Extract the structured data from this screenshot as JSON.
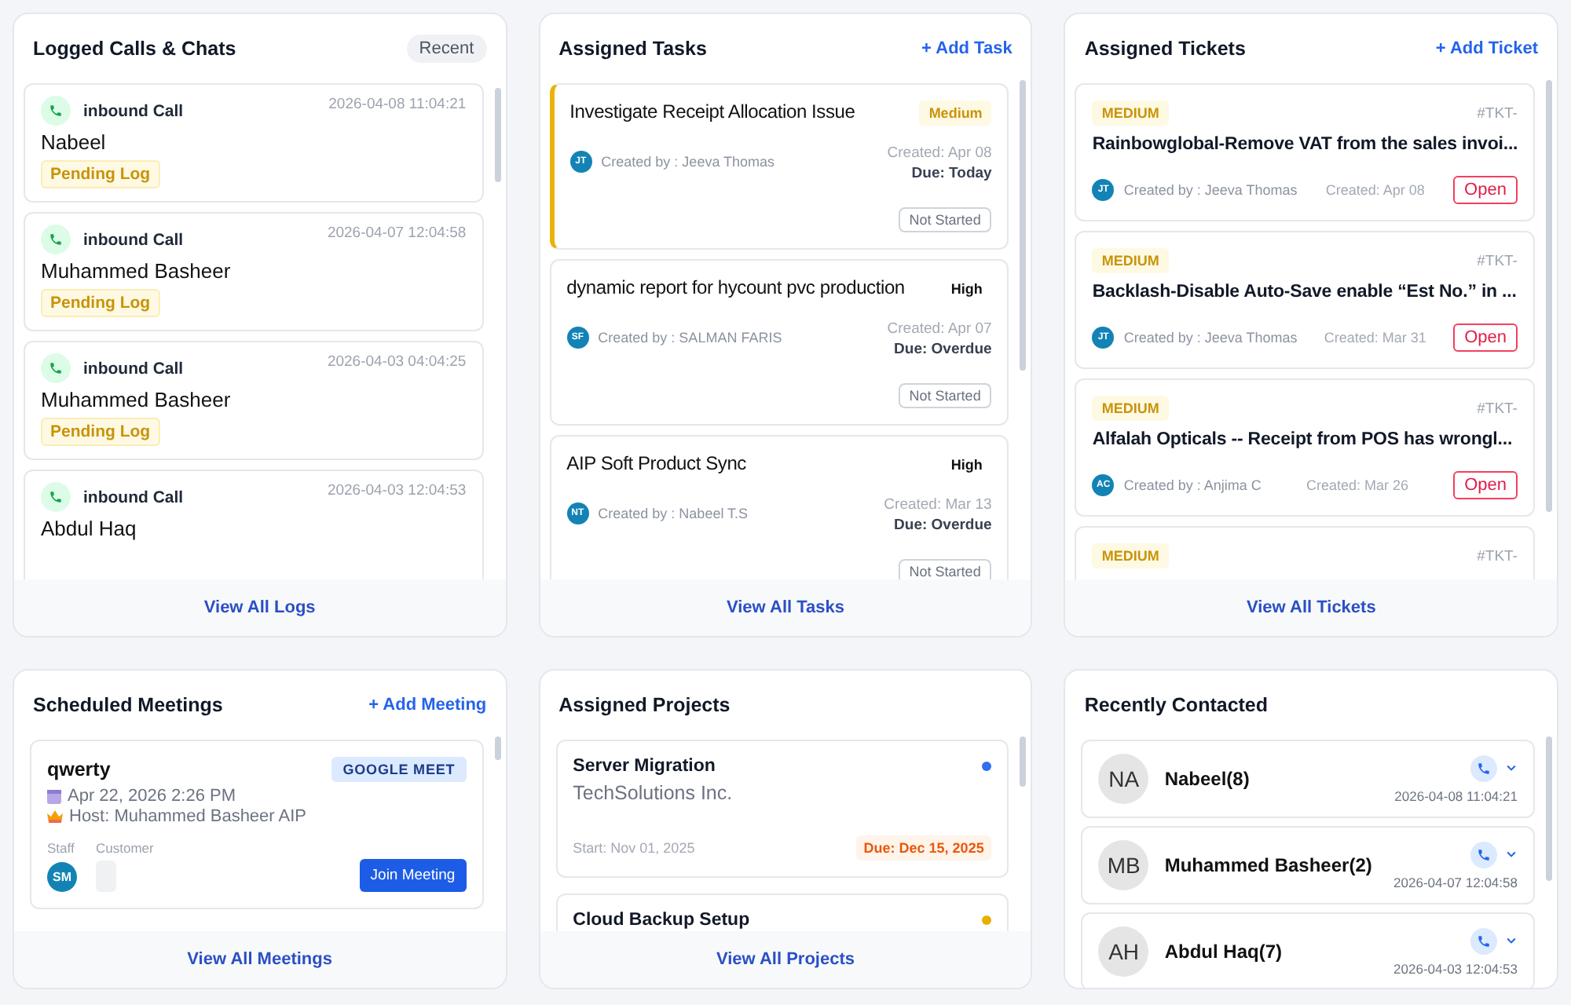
{
  "logs": {
    "title": "Logged Calls & Chats",
    "badge": "Recent",
    "items": [
      {
        "type": "inbound Call",
        "time": "2026-04-08 11:04:21",
        "name": "Nabeel",
        "status": "Pending Log"
      },
      {
        "type": "inbound Call",
        "time": "2026-04-07 12:04:58",
        "name": "Muhammed Basheer",
        "status": "Pending Log"
      },
      {
        "type": "inbound Call",
        "time": "2026-04-03 04:04:25",
        "name": "Muhammed Basheer",
        "status": "Pending Log"
      },
      {
        "type": "inbound Call",
        "time": "2026-04-03 12:04:53",
        "name": "Abdul Haq"
      }
    ],
    "footer": "View All Logs"
  },
  "tasks": {
    "title": "Assigned Tasks",
    "action": "+ Add Task",
    "items": [
      {
        "title": "Investigate Receipt Allocation Issue",
        "priority": "Medium",
        "kind": "medium",
        "initials": "JT",
        "creator": "Created by : Jeeva Thomas",
        "created": "Created: Apr 08",
        "due": "Due: Today",
        "status": "Not Started"
      },
      {
        "title": "dynamic report for hycount pvc production",
        "priority": "High",
        "kind": "high",
        "initials": "SF",
        "creator": "Created by : SALMAN FARIS",
        "created": "Created: Apr 07",
        "due": "Due: Overdue",
        "status": "Not Started"
      },
      {
        "title": "AIP Soft Product Sync",
        "priority": "High",
        "kind": "high",
        "initials": "NT",
        "creator": "Created by : Nabeel T.S",
        "created": "Created: Mar 13",
        "due": "Due: Overdue",
        "status": "Not Started"
      }
    ],
    "footer": "View All Tasks"
  },
  "tickets": {
    "title": "Assigned Tickets",
    "action": "+ Add Ticket",
    "items": [
      {
        "priority": "MEDIUM",
        "id": "#TKT-",
        "title": "Rainbowglobal-Remove VAT from the sales invoi...",
        "initials": "JT",
        "creator": "Created by : Jeeva Thomas",
        "created": "Created: Apr 08",
        "status": "Open"
      },
      {
        "priority": "MEDIUM",
        "id": "#TKT-",
        "title": "Backlash-Disable Auto-Save enable “Est No.” in ...",
        "initials": "JT",
        "creator": "Created by : Jeeva Thomas",
        "created": "Created: Mar 31",
        "status": "Open"
      },
      {
        "priority": "MEDIUM",
        "id": "#TKT-",
        "title": "Alfalah Opticals -- Receipt from POS has wrongl...",
        "initials": "AC",
        "creator": "Created by : Anjima C",
        "created": "Created: Mar 26",
        "status": "Open"
      },
      {
        "priority": "MEDIUM",
        "id": "#TKT-"
      }
    ],
    "footer": "View All Tickets"
  },
  "meetings": {
    "title": "Scheduled Meetings",
    "action": "+ Add Meeting",
    "items": [
      {
        "title": "qwerty",
        "platform": "GOOGLE MEET",
        "date": "Apr 22, 2026 2:26 PM",
        "host": "Host: Muhammed Basheer AIP",
        "staff_label": "Staff",
        "customer_label": "Customer",
        "staff_initials": "SM",
        "join": "Join Meeting"
      }
    ],
    "footer": "View All Meetings"
  },
  "projects": {
    "title": "Assigned Projects",
    "items": [
      {
        "name": "Server Migration",
        "client": "TechSolutions Inc.",
        "color": "#2f6ff0",
        "start": "Start: Nov 01, 2025",
        "due": "Due: Dec 15, 2025"
      },
      {
        "name": "Cloud Backup Setup",
        "color": "#e8b000"
      }
    ],
    "footer": "View All Projects"
  },
  "contacts": {
    "title": "Recently Contacted",
    "items": [
      {
        "initials": "NA",
        "name": "Nabeel(8)",
        "time": "2026-04-08 11:04:21"
      },
      {
        "initials": "MB",
        "name": "Muhammed Basheer(2)",
        "time": "2026-04-07 12:04:58"
      },
      {
        "initials": "AH",
        "name": "Abdul Haq(7)",
        "time": "2026-04-03 12:04:53"
      }
    ]
  }
}
